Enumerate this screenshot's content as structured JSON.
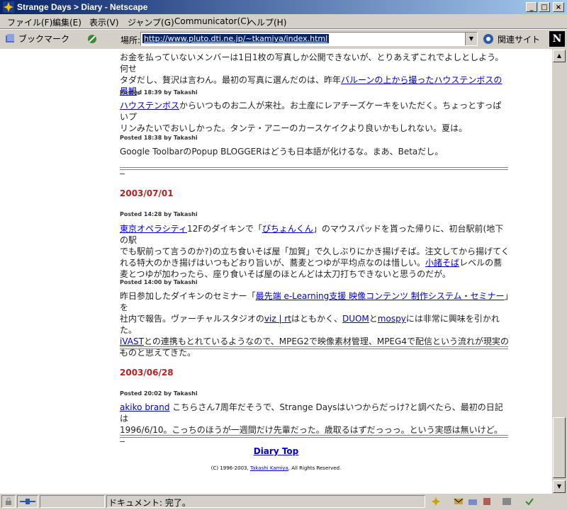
{
  "window": {
    "title": "Strange Days > Diary - Netscape"
  },
  "menu": [
    "ファイル(F)",
    "編集(E)",
    "表示(V)",
    "ジャンプ(G)",
    "Communicator(C)",
    "ヘルプ(H)"
  ],
  "location": {
    "bookmarks_label": "ブックマーク",
    "label": "場所:",
    "url": "http://www.pluto.dti.ne.jp/~tkamiya/index.html",
    "related_label": "関連サイト"
  },
  "entries_top": {
    "line1": "お金を払っていないメンバーは1日1枚の写真しか公開できないが、とりあえずこれでよしとしよう。何せ",
    "line2a": "タダだし、贅沢は言わん。最初の写真に選んだのは、昨年",
    "line2_link": "バルーンの上から撮ったハウステンボスの",
    "line3_link": "景観",
    "line3b": "。"
  },
  "entries": {
    "e1": {
      "posted": "Posted 18:39 by Takashi",
      "link": "ハウステンボス",
      "text1": "からいつものお二人が来社。お土産にレアチーズケーキをいただく。ちょっとすっぱいプ",
      "text2": "リンみたいでおいしかった。タンテ・アニーのカースケイクより良いかもしれない。夏は。"
    },
    "e2": {
      "posted": "Posted 18:38 by Takashi",
      "text": "Google ToolbarのPopup BLOGGERはどうも日本語が化けるな。まあ、Betaだし。"
    },
    "d1": "2003/07/01",
    "e3": {
      "posted": "Posted 14:28 by Takashi",
      "link1": "東京オペラシティ",
      "t1": "12Fのダイキンで「",
      "link2": "ぴちょんくん",
      "t2": "」のマウスパッドを貰った帰りに、初台駅前(地下の駅",
      "line2": "でも駅前って言うのか?)の立ち食いそば屋「加賀」で久しぶりにかき揚げそば。注文してから揚げてく",
      "line3a": "れる特大のかき揚げはいつもどおり旨いが、蕎麦とつゆが平均点なのは惜しい。",
      "link3": "小諸そば",
      "line3b": "レベルの蕎",
      "line4": "麦とつゆが加わったら、座り食いそば屋のほとんどは太刀打ちできないと思うのだが。"
    },
    "e4": {
      "posted": "Posted 14:00 by Takashi",
      "t1": "昨日参加したダイキンのセミナー「",
      "link1": "最先端 e-Learning支援 映像コンテンツ 制作システム・セミナー",
      "t2": "」を",
      "l2a": "社内で報告。ヴァーチャルスタジオの",
      "link2": "viz | rt",
      "l2b": "はともかく、",
      "link3": "DUOM",
      "l2c": "と",
      "link4": "mospy",
      "l2d": "には非常に興味を引かれた。",
      "link5": "iVAST",
      "l3": "との連携もとれているようなので、MPEG2で映像素材管理、MPEG4で配信という流れが現実の",
      "l4": "ものと思えてきた。"
    },
    "d2": "2003/06/28",
    "e5": {
      "posted": "Posted 20:02 by Takashi",
      "link": "akiko brand",
      "t1": " こちらさん7周年だそうで、Strange Daysはいつからだっけ?と調べたら、最初の日記は",
      "t2": "1996/6/10。こっちのほうが一週間だけ先輩だった。歳取るはずだっっっ。という実感は無いけど。"
    }
  },
  "footer": {
    "diary_top": "Diary Top",
    "copy_a": "(C) 1996-2003, ",
    "copy_link": "Takashi Kamiya",
    "copy_b": ", All Rights Reserved."
  },
  "status": {
    "text": "ドキュメント: 完了。"
  }
}
